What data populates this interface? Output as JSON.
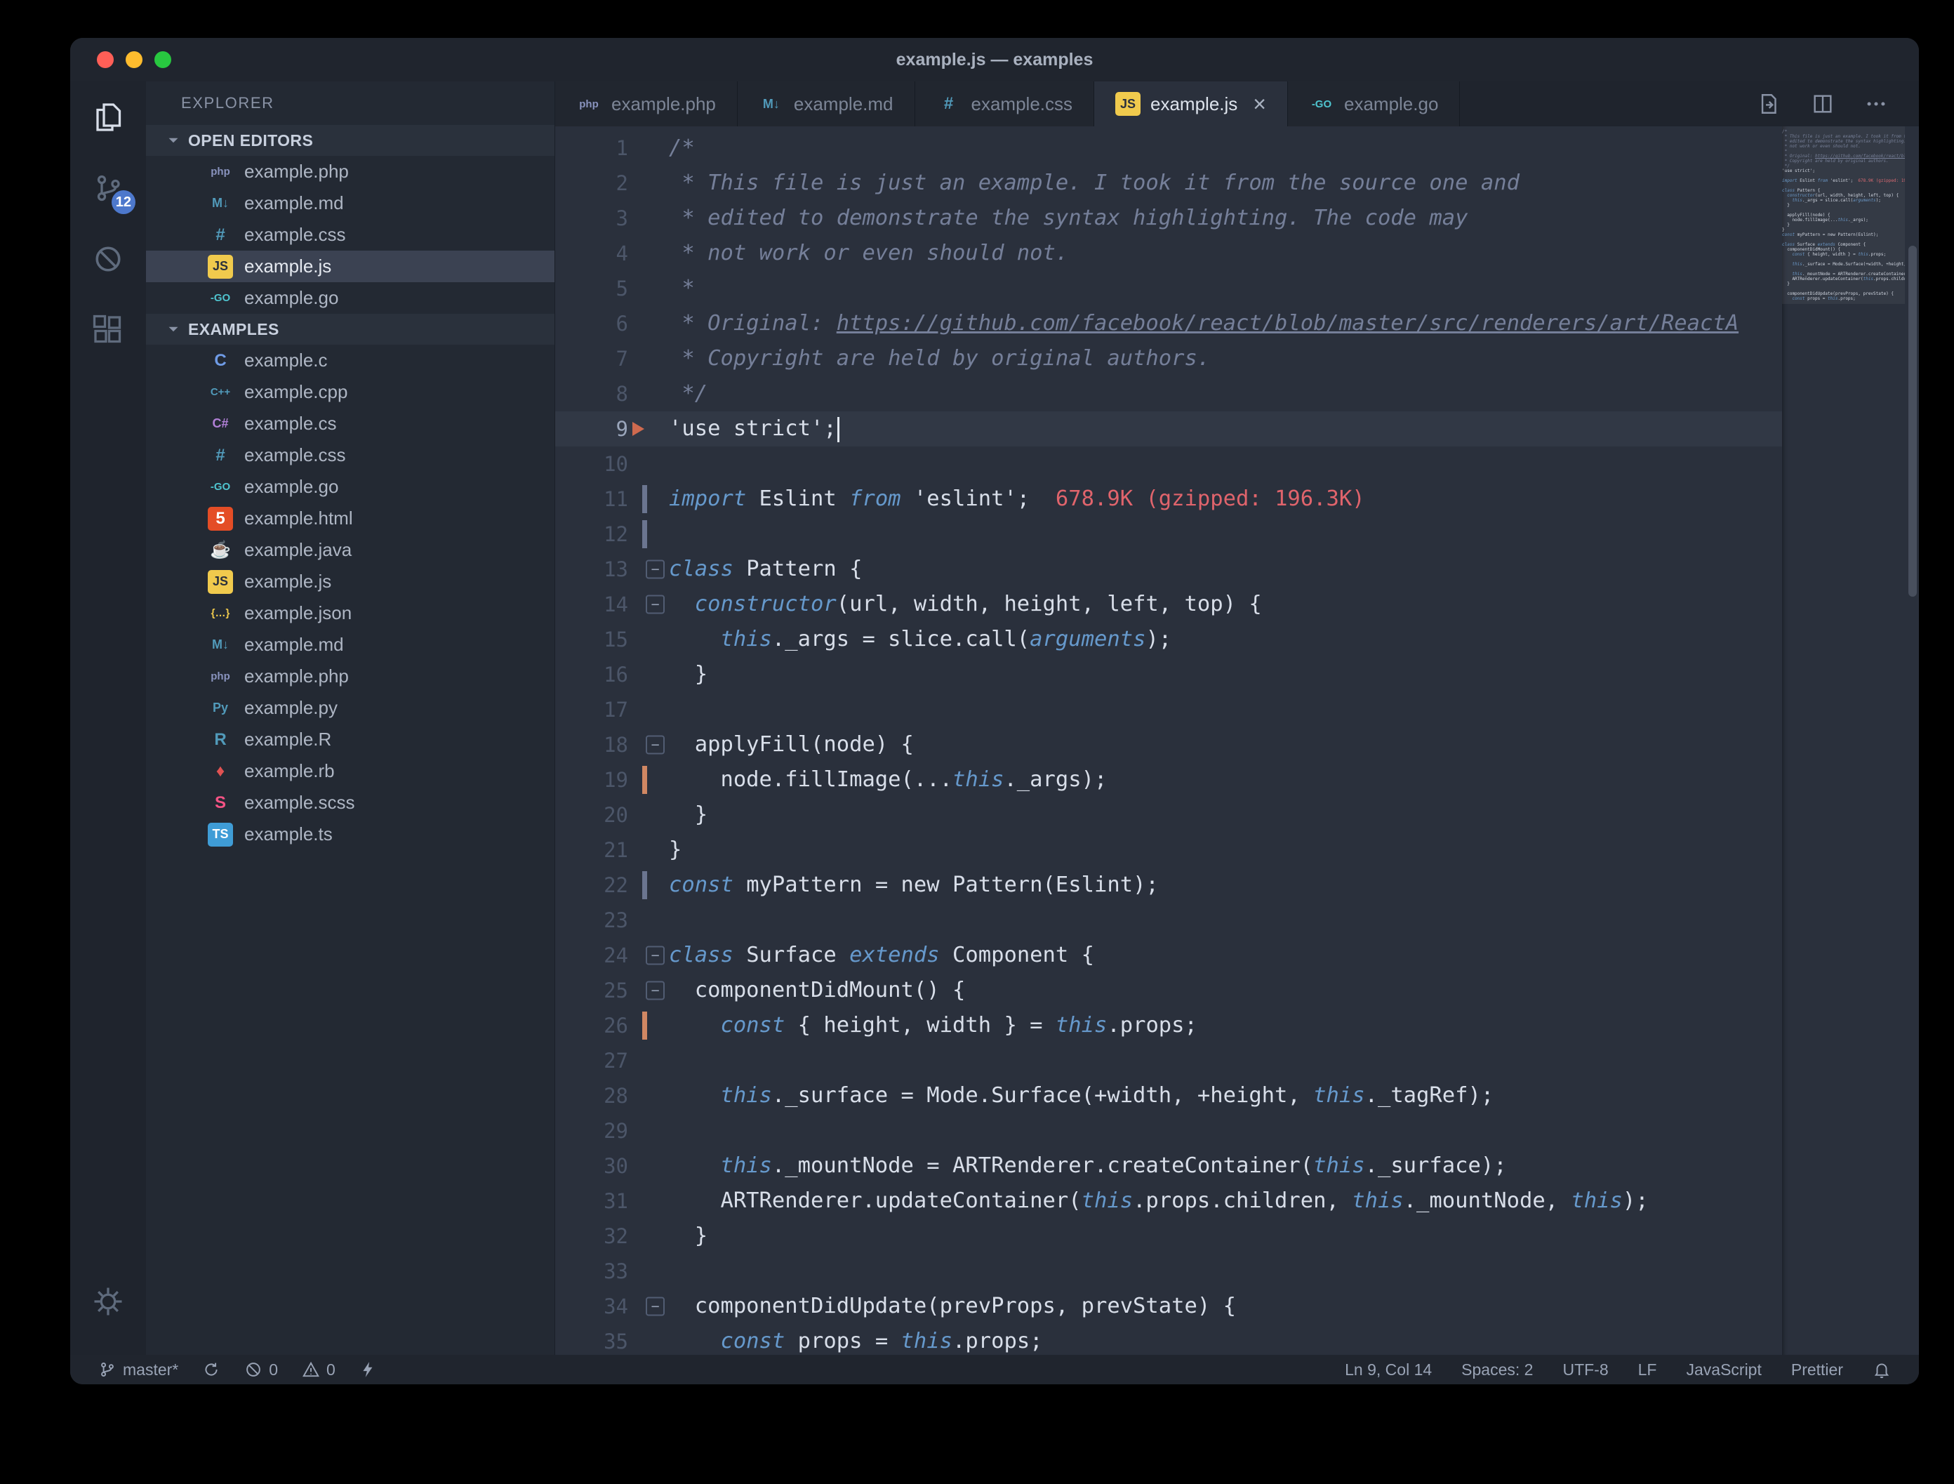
{
  "theme": {
    "editor_bg": "#2a303c",
    "keyword_blue": "#6699cc",
    "comment_gray": "#757f99",
    "foreground": "#d8dee9",
    "import_cost_red": "#e0646c",
    "badge_blue": "#4d78cc"
  },
  "window": {
    "title": "example.js — examples"
  },
  "activity_bar": {
    "items": [
      {
        "name": "explorer",
        "active": true
      },
      {
        "name": "source-control",
        "badge": "12"
      },
      {
        "name": "debug-disabled"
      },
      {
        "name": "extensions"
      }
    ]
  },
  "sidebar": {
    "title": "EXPLORER",
    "sections": [
      {
        "label": "OPEN EDITORS",
        "items": [
          {
            "name": "example.php",
            "icon": "php"
          },
          {
            "name": "example.md",
            "icon": "md"
          },
          {
            "name": "example.css",
            "icon": "css"
          },
          {
            "name": "example.js",
            "icon": "js",
            "selected": true
          },
          {
            "name": "example.go",
            "icon": "go"
          }
        ]
      },
      {
        "label": "EXAMPLES",
        "items": [
          {
            "name": "example.c",
            "icon": "c"
          },
          {
            "name": "example.cpp",
            "icon": "cpp"
          },
          {
            "name": "example.cs",
            "icon": "cs"
          },
          {
            "name": "example.css",
            "icon": "css"
          },
          {
            "name": "example.go",
            "icon": "go"
          },
          {
            "name": "example.html",
            "icon": "html"
          },
          {
            "name": "example.java",
            "icon": "java"
          },
          {
            "name": "example.js",
            "icon": "js"
          },
          {
            "name": "example.json",
            "icon": "json"
          },
          {
            "name": "example.md",
            "icon": "md"
          },
          {
            "name": "example.php",
            "icon": "php"
          },
          {
            "name": "example.py",
            "icon": "py"
          },
          {
            "name": "example.R",
            "icon": "r"
          },
          {
            "name": "example.rb",
            "icon": "rb"
          },
          {
            "name": "example.scss",
            "icon": "scss"
          },
          {
            "name": "example.ts",
            "icon": "ts"
          }
        ]
      }
    ]
  },
  "file_icons": {
    "php": {
      "glyph": "php",
      "color": "#8993be"
    },
    "md": {
      "glyph": "M↓",
      "color": "#519aba"
    },
    "css": {
      "glyph": "#",
      "color": "#519aba"
    },
    "js": {
      "glyph": "JS",
      "color": "#2b313c",
      "bg": "#f0ca4d"
    },
    "go": {
      "glyph": "-GO",
      "color": "#4fc4cf"
    },
    "c": {
      "glyph": "C",
      "color": "#6f9be6"
    },
    "cpp": {
      "glyph": "C++",
      "color": "#519aba"
    },
    "cs": {
      "glyph": "C#",
      "color": "#b180d7"
    },
    "html": {
      "glyph": "5",
      "color": "#ffffff",
      "bg": "#e44d26"
    },
    "java": {
      "glyph": "☕",
      "color": "#cc3e44"
    },
    "json": {
      "glyph": "{…}",
      "color": "#f0ca4d"
    },
    "py": {
      "glyph": "Py",
      "color": "#519aba"
    },
    "r": {
      "glyph": "R",
      "color": "#519aba"
    },
    "rb": {
      "glyph": "♦",
      "color": "#e05252"
    },
    "scss": {
      "glyph": "S",
      "color": "#f55385"
    },
    "ts": {
      "glyph": "TS",
      "color": "#ffffff",
      "bg": "#3f9cd6"
    }
  },
  "tabs": [
    {
      "label": "example.php",
      "icon": "php"
    },
    {
      "label": "example.md",
      "icon": "md"
    },
    {
      "label": "example.css",
      "icon": "css"
    },
    {
      "label": "example.js",
      "icon": "js",
      "active": true,
      "close_glyph": "×"
    },
    {
      "label": "example.go",
      "icon": "go"
    }
  ],
  "tab_actions": [
    "open-changes",
    "split-editor",
    "more-actions"
  ],
  "editor": {
    "active_line": 9,
    "lines": [
      {
        "n": 1,
        "t": [
          [
            "c",
            "/*"
          ]
        ]
      },
      {
        "n": 2,
        "t": [
          [
            "c",
            " * This file is just an example. I took it from the source one and"
          ]
        ]
      },
      {
        "n": 3,
        "t": [
          [
            "c",
            " * edited to demonstrate the syntax highlighting. The code may"
          ]
        ]
      },
      {
        "n": 4,
        "t": [
          [
            "c",
            " * not work or even should not."
          ]
        ]
      },
      {
        "n": 5,
        "t": [
          [
            "c",
            " *"
          ]
        ]
      },
      {
        "n": 6,
        "t": [
          [
            "c",
            " * Original: "
          ],
          [
            "u",
            "https://github.com/facebook/react/blob/master/src/renderers/art/ReactA"
          ]
        ]
      },
      {
        "n": 7,
        "t": [
          [
            "c",
            " * Copyright are held by original authors."
          ]
        ]
      },
      {
        "n": 8,
        "t": [
          [
            "c",
            " */"
          ]
        ]
      },
      {
        "n": 9,
        "t": [
          [
            "f",
            "'use strict';"
          ]
        ],
        "cursor": true,
        "marker": "arrow"
      },
      {
        "n": 10,
        "t": []
      },
      {
        "n": 11,
        "t": [
          [
            "k",
            "import"
          ],
          [
            "f",
            " Eslint "
          ],
          [
            "k",
            "from"
          ],
          [
            "f",
            " 'eslint';  "
          ],
          [
            "r",
            "678.9K (gzipped: 196.3K)"
          ]
        ],
        "gut": "gray"
      },
      {
        "n": 12,
        "t": [],
        "gut": "gray"
      },
      {
        "n": 13,
        "t": [
          [
            "k",
            "class"
          ],
          [
            "f",
            " Pattern {"
          ]
        ],
        "fold": true
      },
      {
        "n": 14,
        "t": [
          [
            "f",
            "  "
          ],
          [
            "k",
            "constructor"
          ],
          [
            "f",
            "(url, width, height, left, top) {"
          ]
        ],
        "fold": true
      },
      {
        "n": 15,
        "t": [
          [
            "f",
            "    "
          ],
          [
            "k",
            "this"
          ],
          [
            "f",
            "._args = slice.call("
          ],
          [
            "k",
            "arguments"
          ],
          [
            "f",
            ");"
          ]
        ]
      },
      {
        "n": 16,
        "t": [
          [
            "f",
            "  }"
          ]
        ]
      },
      {
        "n": 17,
        "t": []
      },
      {
        "n": 18,
        "t": [
          [
            "f",
            "  applyFill(node) {"
          ]
        ],
        "fold": true
      },
      {
        "n": 19,
        "t": [
          [
            "f",
            "    node.fillImage(..."
          ],
          [
            "k",
            "this"
          ],
          [
            "f",
            "._args);"
          ]
        ],
        "gut": "orange"
      },
      {
        "n": 20,
        "t": [
          [
            "f",
            "  }"
          ]
        ]
      },
      {
        "n": 21,
        "t": [
          [
            "f",
            "}"
          ]
        ]
      },
      {
        "n": 22,
        "t": [
          [
            "k",
            "const"
          ],
          [
            "f",
            " myPattern = new Pattern(Eslint);"
          ]
        ],
        "gut": "gray"
      },
      {
        "n": 23,
        "t": []
      },
      {
        "n": 24,
        "t": [
          [
            "k",
            "class"
          ],
          [
            "f",
            " Surface "
          ],
          [
            "k",
            "extends"
          ],
          [
            "f",
            " Component {"
          ]
        ],
        "fold": true
      },
      {
        "n": 25,
        "t": [
          [
            "f",
            "  componentDidMount() {"
          ]
        ],
        "fold": true
      },
      {
        "n": 26,
        "t": [
          [
            "f",
            "    "
          ],
          [
            "k",
            "const"
          ],
          [
            "f",
            " { height, width } = "
          ],
          [
            "k",
            "this"
          ],
          [
            "f",
            ".props;"
          ]
        ],
        "gut": "orange"
      },
      {
        "n": 27,
        "t": []
      },
      {
        "n": 28,
        "t": [
          [
            "f",
            "    "
          ],
          [
            "k",
            "this"
          ],
          [
            "f",
            "._surface = Mode.Surface(+width, +height, "
          ],
          [
            "k",
            "this"
          ],
          [
            "f",
            "._tagRef);"
          ]
        ]
      },
      {
        "n": 29,
        "t": []
      },
      {
        "n": 30,
        "t": [
          [
            "f",
            "    "
          ],
          [
            "k",
            "this"
          ],
          [
            "f",
            "._mountNode = ARTRenderer.createContainer("
          ],
          [
            "k",
            "this"
          ],
          [
            "f",
            "._surface);"
          ]
        ]
      },
      {
        "n": 31,
        "t": [
          [
            "f",
            "    ARTRenderer.updateContainer("
          ],
          [
            "k",
            "this"
          ],
          [
            "f",
            ".props.children, "
          ],
          [
            "k",
            "this"
          ],
          [
            "f",
            "._mountNode, "
          ],
          [
            "k",
            "this"
          ],
          [
            "f",
            ");"
          ]
        ]
      },
      {
        "n": 32,
        "t": [
          [
            "f",
            "  }"
          ]
        ]
      },
      {
        "n": 33,
        "t": []
      },
      {
        "n": 34,
        "t": [
          [
            "f",
            "  componentDidUpdate(prevProps, prevState) {"
          ]
        ],
        "fold": true
      },
      {
        "n": 35,
        "t": [
          [
            "f",
            "    "
          ],
          [
            "k",
            "const"
          ],
          [
            "f",
            " props = "
          ],
          [
            "k",
            "this"
          ],
          [
            "f",
            ".props;"
          ]
        ]
      }
    ]
  },
  "status_bar": {
    "left": [
      {
        "icon": "git-branch",
        "label": "master*"
      },
      {
        "icon": "sync",
        "label": ""
      },
      {
        "icon": "error",
        "label": "0"
      },
      {
        "icon": "warning",
        "label": "0"
      },
      {
        "icon": "lightning",
        "label": ""
      }
    ],
    "right": [
      {
        "label": "Ln 9, Col 14"
      },
      {
        "label": "Spaces: 2"
      },
      {
        "label": "UTF-8"
      },
      {
        "label": "LF"
      },
      {
        "label": "JavaScript"
      },
      {
        "label": "Prettier"
      },
      {
        "icon": "bell",
        "label": ""
      }
    ]
  }
}
